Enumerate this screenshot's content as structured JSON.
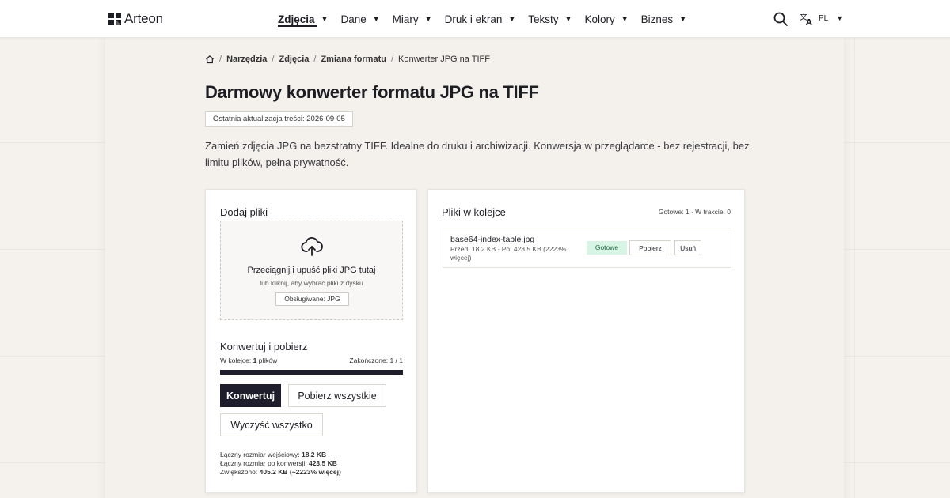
{
  "header": {
    "logo_text": "Arteon",
    "nav": [
      {
        "label": "Zdjęcia",
        "active": true
      },
      {
        "label": "Dane"
      },
      {
        "label": "Miary"
      },
      {
        "label": "Druk i ekran"
      },
      {
        "label": "Teksty"
      },
      {
        "label": "Kolory"
      },
      {
        "label": "Biznes"
      }
    ],
    "lang": "PL",
    "icons": {
      "search": "search-icon",
      "translate": "translate-icon",
      "home": "home-icon",
      "upload": "cloud-upload-icon"
    }
  },
  "breadcrumb": [
    "Narzędzia",
    "Zdjęcia",
    "Zmiana formatu",
    "Konwerter JPG na TIFF"
  ],
  "page": {
    "title": "Darmowy konwerter formatu JPG na TIFF",
    "updated": "Ostatnia aktualizacja treści: 2026-09-05",
    "intro": "Zamień zdjęcia JPG na bezstratny TIFF. Idealne do druku i archiwizacji. Konwersja w przeglądarce - bez rejestracji, bez limitu plików, pełna prywatność."
  },
  "upload": {
    "title": "Dodaj pliki",
    "drop_main": "Przeciągnij i upuść pliki JPG tutaj",
    "drop_sub": "lub kliknij, aby wybrać pliki z dysku",
    "supported": "Obsługiwane: JPG"
  },
  "convert": {
    "title": "Konwertuj i pobierz",
    "queue_prefix": "W kolejce: ",
    "queue_count": "1",
    "queue_suffix": " plików",
    "done": "Zakończone: 1 / 1",
    "progress": 1.0,
    "btn_convert": "Konwertuj",
    "btn_download_all": "Pobierz wszystkie",
    "btn_clear": "Wyczyść wszystko",
    "stat1_label": "Łączny rozmiar wejściowy: ",
    "stat1_value": "18.2 KB",
    "stat2_label": "Łączny rozmiar po konwersji: ",
    "stat2_value": "423.5 KB",
    "stat3_label": "Zwiększono: ",
    "stat3_value": "405.2 KB (~2223% więcej)"
  },
  "queue": {
    "title": "Pliki w kolejce",
    "summary": "Gotowe: 1 · W trakcie: 0",
    "files": [
      {
        "name": "base64-index-table.jpg",
        "meta": "Przed: 18.2 KB · Po: 423.5 KB (2223% więcej)",
        "status": "Gotowe",
        "download": "Pobierz",
        "remove": "Usuń"
      }
    ]
  },
  "colors": {
    "primary": "#1d1d2b",
    "success_bg": "#d8f4e4",
    "success_text": "#1e6b40",
    "background": "#f5f2ee"
  }
}
